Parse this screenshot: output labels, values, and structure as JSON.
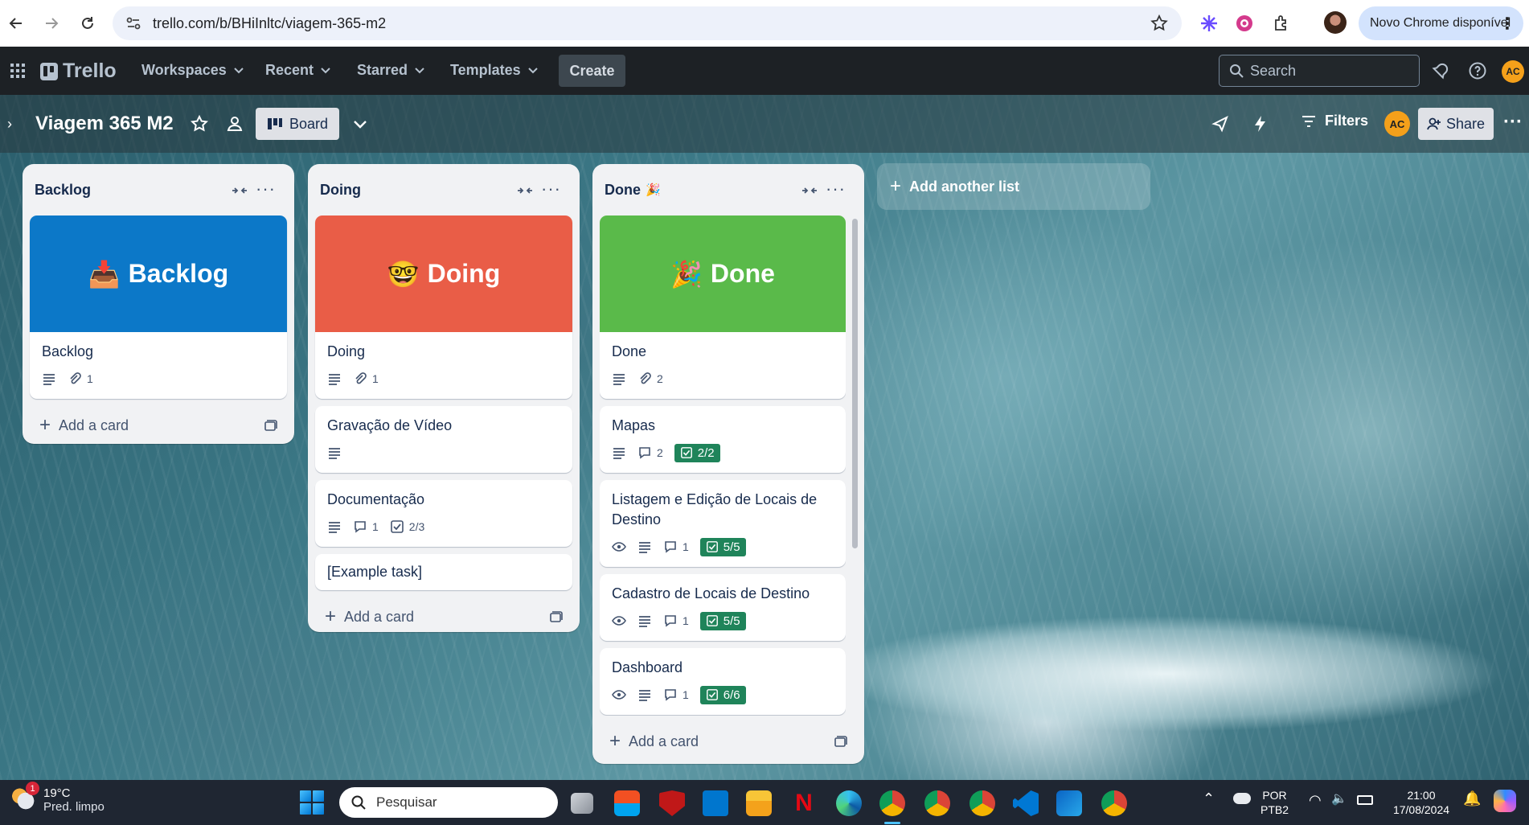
{
  "browser": {
    "url": "trello.com/b/BHiInltc/viagem-365-m2",
    "update_label": "Novo Chrome disponível"
  },
  "header": {
    "logo": "Trello",
    "menus": [
      "Workspaces",
      "Recent",
      "Starred",
      "Templates"
    ],
    "create_label": "Create",
    "search_placeholder": "Search",
    "avatar_initials": "AC"
  },
  "board": {
    "title": "Viagem 365 M2",
    "view_label": "Board",
    "filters_label": "Filters",
    "share_label": "Share",
    "avatar_initials": "AC",
    "add_list_label": "Add another list"
  },
  "lists": [
    {
      "title": "Backlog",
      "cover": {
        "emoji": "📥",
        "text": "Backlog",
        "color": "#0c78c8"
      },
      "cover_card": {
        "title": "Backlog",
        "attachments": "1"
      },
      "cards": [],
      "add_card_label": "Add a card"
    },
    {
      "title": "Doing",
      "cover": {
        "emoji": "🤓",
        "text": "Doing",
        "color": "#e95d47"
      },
      "cover_card": {
        "title": "Doing",
        "attachments": "1"
      },
      "cards": [
        {
          "title": "Gravação de Vídeo"
        },
        {
          "title": "Documentação",
          "comments": "1",
          "checklist": "2/3"
        },
        {
          "title": "[Example task]"
        }
      ],
      "add_card_label": "Add a card"
    },
    {
      "title": "Done",
      "title_emoji": "🎉",
      "cover": {
        "emoji": "🎉",
        "text": "Done",
        "color": "#5aba4a"
      },
      "cover_card": {
        "title": "Done",
        "attachments": "2"
      },
      "cards": [
        {
          "title": "Mapas",
          "comments": "2",
          "checklist": "2/2"
        },
        {
          "title": "Listagem e Edição de Locais de Destino",
          "comments": "1",
          "checklist": "5/5"
        },
        {
          "title": "Cadastro de Locais de Destino",
          "comments": "1",
          "checklist": "5/5"
        },
        {
          "title": "Dashboard",
          "comments": "1",
          "checklist": "6/6"
        }
      ],
      "add_card_label": "Add a card"
    }
  ],
  "taskbar": {
    "temperature": "19°C",
    "weather": "Pred. limpo",
    "weather_badge": "1",
    "search_placeholder": "Pesquisar",
    "lang_top": "POR",
    "lang_bottom": "PTB2",
    "time": "21:00",
    "date": "17/08/2024"
  }
}
